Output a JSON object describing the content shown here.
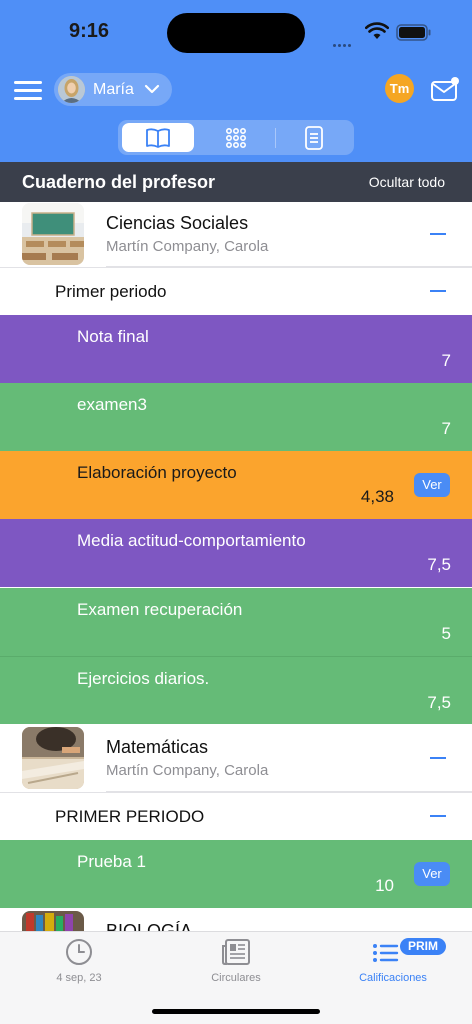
{
  "status_bar": {
    "time": "9:16"
  },
  "header": {
    "user_name": "María",
    "badge_text": "Tm",
    "accent_color": "#4f8ff7"
  },
  "segmented_control": {
    "segments": [
      {
        "icon": "book-icon",
        "selected": true
      },
      {
        "icon": "grid-icon",
        "selected": false
      },
      {
        "icon": "document-icon",
        "selected": false
      }
    ]
  },
  "section": {
    "title": "Cuaderno del profesor",
    "hide_all": "Ocultar todo"
  },
  "subjects": [
    {
      "name": "Ciencias Sociales",
      "teacher": "Martín Company, Carola",
      "period": "Primer periodo",
      "grades": [
        {
          "name": "Nota final",
          "value": "7",
          "color": "#7e57c2"
        },
        {
          "name": "examen3",
          "value": "7",
          "color": "#65bb77"
        },
        {
          "name": "Elaboración proyecto",
          "value": "4,38",
          "color": "#fba42d",
          "button": "Ver"
        },
        {
          "name": "Media actitud-comportamiento",
          "value": "7,5",
          "color": "#7e57c2"
        },
        {
          "name": "Examen recuperación",
          "value": "5",
          "color": "#65bb77"
        },
        {
          "name": "Ejercicios diarios.",
          "value": "7,5",
          "color": "#65bb77"
        }
      ]
    },
    {
      "name": "Matemáticas",
      "teacher": "Martín Company, Carola",
      "period": "PRIMER PERIODO",
      "grades": [
        {
          "name": "Prueba 1",
          "value": "10",
          "color": "#65bb77",
          "button": "Ver"
        }
      ]
    },
    {
      "name": "BIOLOGÍA"
    }
  ],
  "tab_bar": {
    "tabs": [
      {
        "label": "4 sep, 23",
        "icon": "clock-icon"
      },
      {
        "label": "Circulares",
        "icon": "newspaper-icon"
      },
      {
        "label": "Calificaciones",
        "icon": "list-icon",
        "badge": "PRIM",
        "active": true
      }
    ]
  }
}
